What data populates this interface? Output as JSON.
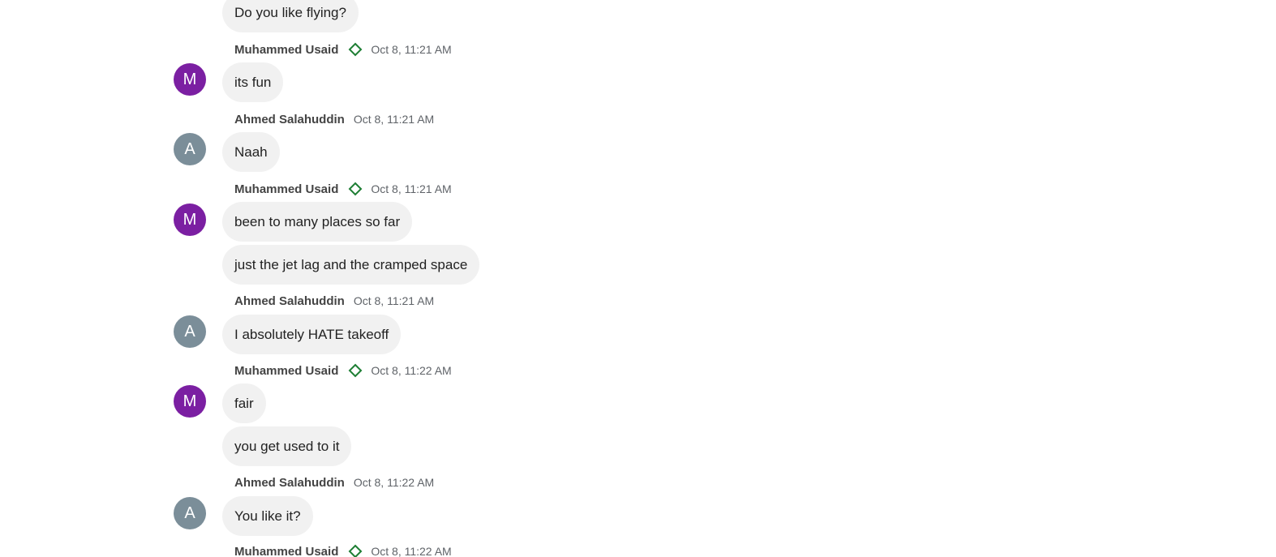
{
  "colors": {
    "avatar_m": "#7b1fa2",
    "avatar_a": "#7b8e99",
    "bubble_bg": "#f1f1f1",
    "badge": "#1e7e34"
  },
  "icons": {
    "badge": "diamond-outline-icon"
  },
  "messages": {
    "m0": {
      "text": "Do you like flying?"
    },
    "g1": {
      "sender": "Muhammed Usaid",
      "time": "Oct 8, 11:21 AM",
      "avatar": "M",
      "texts": [
        "its fun"
      ]
    },
    "g2": {
      "sender": "Ahmed Salahuddin",
      "time": "Oct 8, 11:21 AM",
      "avatar": "A",
      "texts": [
        "Naah"
      ]
    },
    "g3": {
      "sender": "Muhammed Usaid",
      "time": "Oct 8, 11:21 AM",
      "avatar": "M",
      "texts": [
        "been to many places so far",
        "just the jet lag and the cramped space"
      ]
    },
    "g4": {
      "sender": "Ahmed Salahuddin",
      "time": "Oct 8, 11:21 AM",
      "avatar": "A",
      "texts": [
        "I absolutely HATE takeoff"
      ]
    },
    "g5": {
      "sender": "Muhammed Usaid",
      "time": "Oct 8, 11:22 AM",
      "avatar": "M",
      "texts": [
        "fair",
        "you get used to it"
      ]
    },
    "g6": {
      "sender": "Ahmed Salahuddin",
      "time": "Oct 8, 11:22 AM",
      "avatar": "A",
      "texts": [
        "You like it?"
      ]
    },
    "g7": {
      "sender": "Muhammed Usaid",
      "time": "Oct 8, 11:22 AM"
    }
  }
}
